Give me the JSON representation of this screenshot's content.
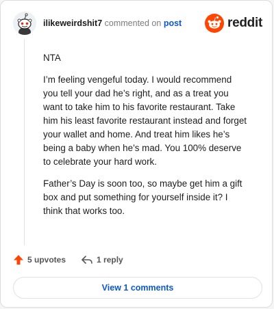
{
  "comment": {
    "username": "ilikeweirdshit7",
    "meta_text": "commented on",
    "post_link": "post",
    "paragraphs": [
      "NTA",
      "I’m feeling vengeful today. I would recommend you tell your dad he’s right, and as a treat you want to take him to his favorite restaurant. Take him his least favorite restaurant instead and forget your wallet and home. And treat him likes he’s being a baby when he’s mad. You 100% deserve to celebrate your hard work.",
      "Father’s Day is soon too, so maybe get him a gift box and put something for yourself inside it? I think that works too."
    ]
  },
  "brand": {
    "logo_text": "reddit",
    "accent": "#ff4500"
  },
  "actions": {
    "upvotes": "5 upvotes",
    "reply": "1 reply",
    "upvote_icon": "upvote-arrow-icon",
    "reply_icon": "reply-arrow-icon"
  },
  "footer": {
    "view_comments": "View 1 comments",
    "link_color": "#0a58ca"
  }
}
